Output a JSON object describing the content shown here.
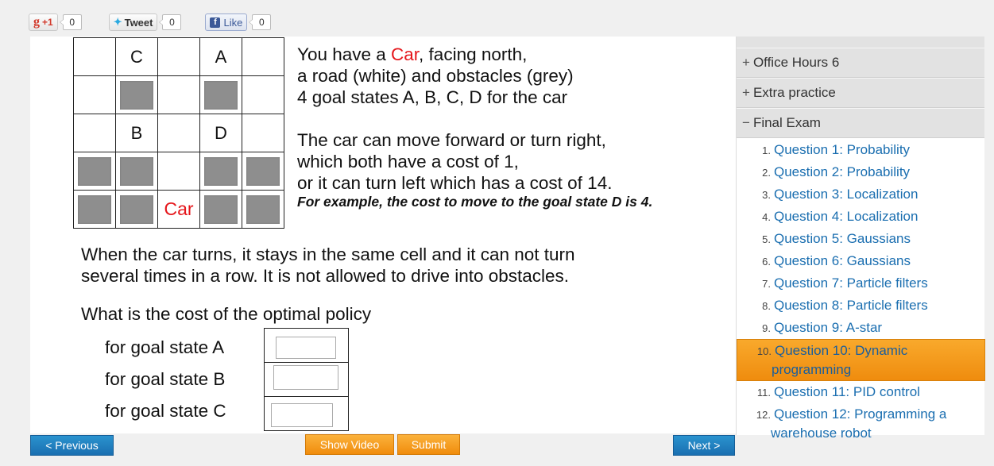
{
  "social": {
    "gplus": {
      "label": "+1",
      "count": "0"
    },
    "tweet": {
      "label": "Tweet",
      "count": "0"
    },
    "like": {
      "label": "Like",
      "count": "0"
    }
  },
  "grid": [
    [
      "",
      "C",
      "",
      "A",
      ""
    ],
    [
      "",
      "#",
      "",
      "#",
      ""
    ],
    [
      "",
      "B",
      "",
      "D",
      ""
    ],
    [
      "#",
      "#",
      "",
      "#",
      "#"
    ],
    [
      "#",
      "#",
      "Car",
      "#",
      "#"
    ]
  ],
  "description": {
    "line1_pre": "You have a ",
    "line1_car": "Car",
    "line1_post": ", facing north,",
    "line2": "a road (white) and obstacles (grey)",
    "line3": "4 goal states A, B, C, D for the car",
    "line4": "The car can move forward or turn right,",
    "line5": "which both have a cost of 1,",
    "line6": "or it can turn left which has a cost of 14.",
    "example": "For example, the cost to move to the goal state D is 4."
  },
  "turns": {
    "line1": "When the car turns, it stays in the same cell and it can not turn",
    "line2": "several times in a row. It is not allowed to drive into obstacles."
  },
  "question": "What is the cost of the optimal policy",
  "goals": [
    {
      "label": "for goal state A",
      "value": ""
    },
    {
      "label": "for goal state B",
      "value": ""
    },
    {
      "label": "for goal state C",
      "value": ""
    }
  ],
  "buttons": {
    "previous": "< Previous",
    "show_video": "Show Video",
    "submit": "Submit",
    "next": "Next >"
  },
  "sidebar": {
    "sections": [
      {
        "symbol": "+",
        "label": "Office Hours 6"
      },
      {
        "symbol": "+",
        "label": "Extra practice"
      },
      {
        "symbol": "−",
        "label": "Final Exam"
      }
    ],
    "items": [
      {
        "num": "1.",
        "label": "Question 1: Probability"
      },
      {
        "num": "2.",
        "label": "Question 2: Probability"
      },
      {
        "num": "3.",
        "label": "Question 3: Localization"
      },
      {
        "num": "4.",
        "label": "Question 4: Localization"
      },
      {
        "num": "5.",
        "label": "Question 5: Gaussians"
      },
      {
        "num": "6.",
        "label": "Question 6: Gaussians"
      },
      {
        "num": "7.",
        "label": "Question 7: Particle filters"
      },
      {
        "num": "8.",
        "label": "Question 8: Particle filters"
      },
      {
        "num": "9.",
        "label": "Question 9: A-star"
      },
      {
        "num": "10.",
        "label": "Question 10: Dynamic",
        "label2": "programming"
      },
      {
        "num": "11.",
        "label": "Question 11: PID control"
      },
      {
        "num": "12.",
        "label": "Question 12: Programming a",
        "label2": "warehouse robot"
      }
    ]
  },
  "colors": {
    "accent_orange": "#f39c12",
    "link_blue": "#1a6eb0",
    "car_red": "#e5161b",
    "button_blue": "#1e7fc0"
  }
}
